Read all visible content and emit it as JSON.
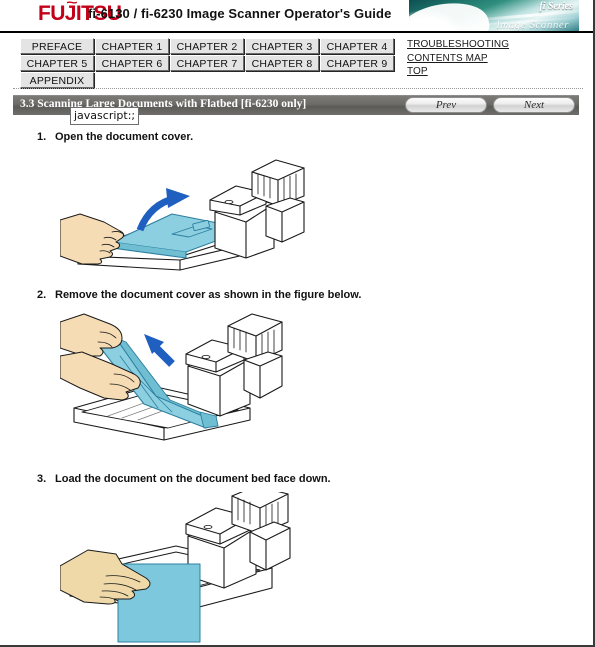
{
  "window": {
    "border_color": "#3a3a3a"
  },
  "header": {
    "logo_text": "FUJITSU",
    "logo_color": "#c30019",
    "logo_tilde": "~",
    "doc_title": "fi-6130 / fi-6230 Image Scanner Operator's Guide",
    "banner": {
      "brand_mark": "fi Series",
      "script_word": "Image Scanner",
      "accent_color": "#1b6e66"
    }
  },
  "nav": {
    "rows": [
      [
        {
          "label": "PREFACE",
          "name": "nav-button-preface"
        },
        {
          "label": "CHAPTER 1",
          "name": "nav-button-chapter-1"
        },
        {
          "label": "CHAPTER 2",
          "name": "nav-button-chapter-2"
        },
        {
          "label": "CHAPTER 3",
          "name": "nav-button-chapter-3"
        },
        {
          "label": "CHAPTER 4",
          "name": "nav-button-chapter-4"
        }
      ],
      [
        {
          "label": "CHAPTER 5",
          "name": "nav-button-chapter-5"
        },
        {
          "label": "CHAPTER 6",
          "name": "nav-button-chapter-6"
        },
        {
          "label": "CHAPTER 7",
          "name": "nav-button-chapter-7"
        },
        {
          "label": "CHAPTER 8",
          "name": "nav-button-chapter-8"
        },
        {
          "label": "CHAPTER 9",
          "name": "nav-button-chapter-9"
        }
      ],
      [
        {
          "label": "APPENDIX",
          "name": "nav-button-appendix"
        }
      ]
    ],
    "links": [
      {
        "label": "TROUBLESHOOTING",
        "name": "link-troubleshooting"
      },
      {
        "label": "CONTENTS MAP",
        "name": "link-contents-map"
      },
      {
        "label": "TOP",
        "name": "link-top"
      }
    ]
  },
  "section": {
    "title": "3.3 Scanning Large Documents with Flatbed [fi-6230 only]",
    "bar_color": "#6b6a67",
    "prev_label": "Prev",
    "next_label": "Next"
  },
  "tooltip": {
    "text": "javascript:;"
  },
  "steps": [
    {
      "number": "1.",
      "text": "Open the document cover."
    },
    {
      "number": "2.",
      "text": "Remove the document cover as shown in the figure below."
    },
    {
      "number": "3.",
      "text": "Load the document on the document bed face down."
    }
  ],
  "figures": [
    {
      "name": "figure-open-document-cover",
      "alt": "Hand lifting the blue document cover open on the flatbed scanner",
      "document_color": "#8ccfe0",
      "hand_color": "#f6dcb4",
      "arrow_color": "#1f5fbf",
      "outline_color": "#1a1a1a"
    },
    {
      "name": "figure-remove-document-cover",
      "alt": "Two hands lifting the document cover away from the flatbed scanner",
      "document_color": "#8ccfe0",
      "hand_color": "#f6dcb4",
      "arrow_color": "#1f5fbf",
      "outline_color": "#1a1a1a"
    },
    {
      "name": "figure-load-document-face-down",
      "alt": "Hand placing a large blue document face down on the document bed",
      "document_color": "#7ec8dd",
      "hand_color": "#f0d9a8",
      "outline_color": "#1a1a1a"
    }
  ]
}
